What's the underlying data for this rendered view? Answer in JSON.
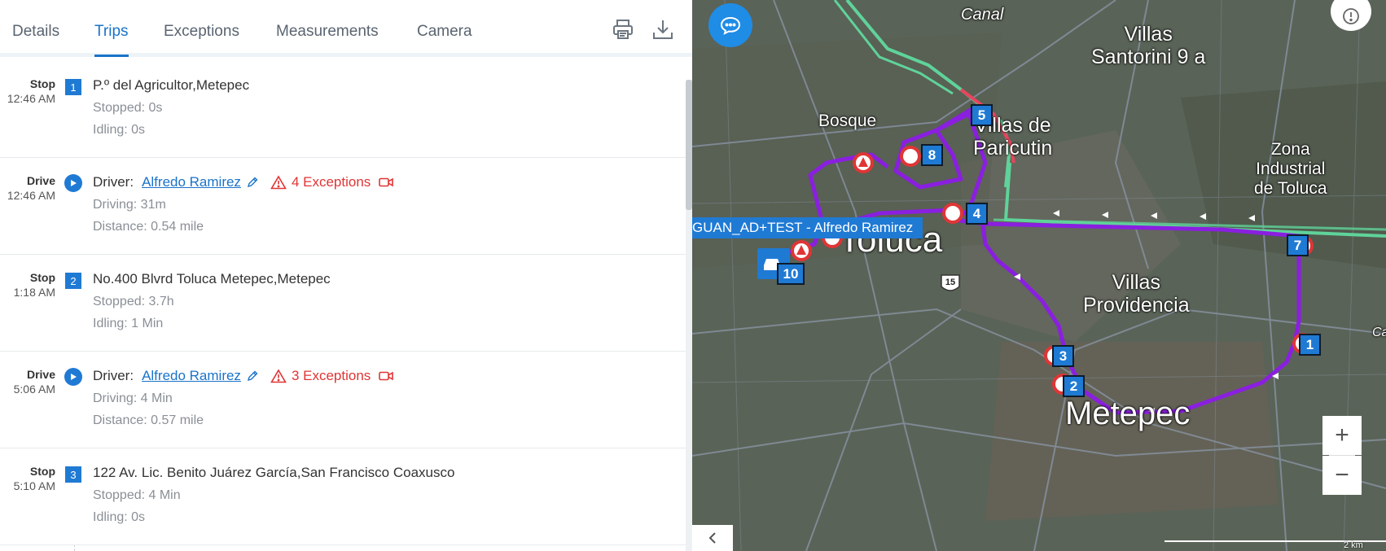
{
  "tabs": [
    "Details",
    "Trips",
    "Exceptions",
    "Measurements",
    "Camera"
  ],
  "active_tab": "Trips",
  "toolbar": {
    "print_icon": "printer-icon",
    "download_icon": "download-icon"
  },
  "accent_color": "#1a73c9",
  "exception_color": "#e03535",
  "trips": [
    {
      "kind": "Stop",
      "time": "12:46 AM",
      "badge": "1",
      "address": "P.º del Agricultor,Metepec",
      "line1": "Stopped: 0s",
      "line2": "Idling: 0s"
    },
    {
      "kind": "Drive",
      "time": "12:46 AM",
      "driver_label": "Driver:",
      "driver": "Alfredo Ramirez",
      "exceptions": "4 Exceptions",
      "line1": "Driving: 31m",
      "line2": "Distance: 0.54 mile"
    },
    {
      "kind": "Stop",
      "time": "1:18 AM",
      "badge": "2",
      "address": "No.400 Blvrd Toluca Metepec,Metepec",
      "line1": "Stopped: 3.7h",
      "line2": "Idling: 1 Min"
    },
    {
      "kind": "Drive",
      "time": "5:06 AM",
      "driver_label": "Driver:",
      "driver": "Alfredo Ramirez",
      "exceptions": "3 Exceptions",
      "line1": "Driving: 4 Min",
      "line2": "Distance: 0.57 mile"
    },
    {
      "kind": "Stop",
      "time": "5:10 AM",
      "badge": "3",
      "address": "122 Av. Lic. Benito Juárez García,San Francisco Coaxusco",
      "line1": "Stopped: 4 Min",
      "line2": "Idling: 0s"
    }
  ],
  "map": {
    "place_labels": [
      "Villas\nSantorini 9 a",
      "Bosque",
      "Villas de\nParicutin",
      "Zona\nIndustrial\nde Toluca",
      "Toluca",
      "Villas\nProvidencia",
      "Metepec",
      "Canal",
      "Ca"
    ],
    "vehicle_label": "GUAN_AD+TEST - Alfredo Ramirez",
    "stop_markers": [
      "1",
      "2",
      "3",
      "4",
      "5",
      "7",
      "8",
      "10"
    ],
    "highway_shield": "15",
    "zoom_in": "+",
    "zoom_out": "−",
    "scale_text": "2 km",
    "route_color": "#8a1fe0",
    "road_color": "#5fd39a",
    "chat_icon": "chat-bubble-icon",
    "info_icon": "alert-info-icon",
    "collapse_icon": "chevron-left-icon"
  }
}
